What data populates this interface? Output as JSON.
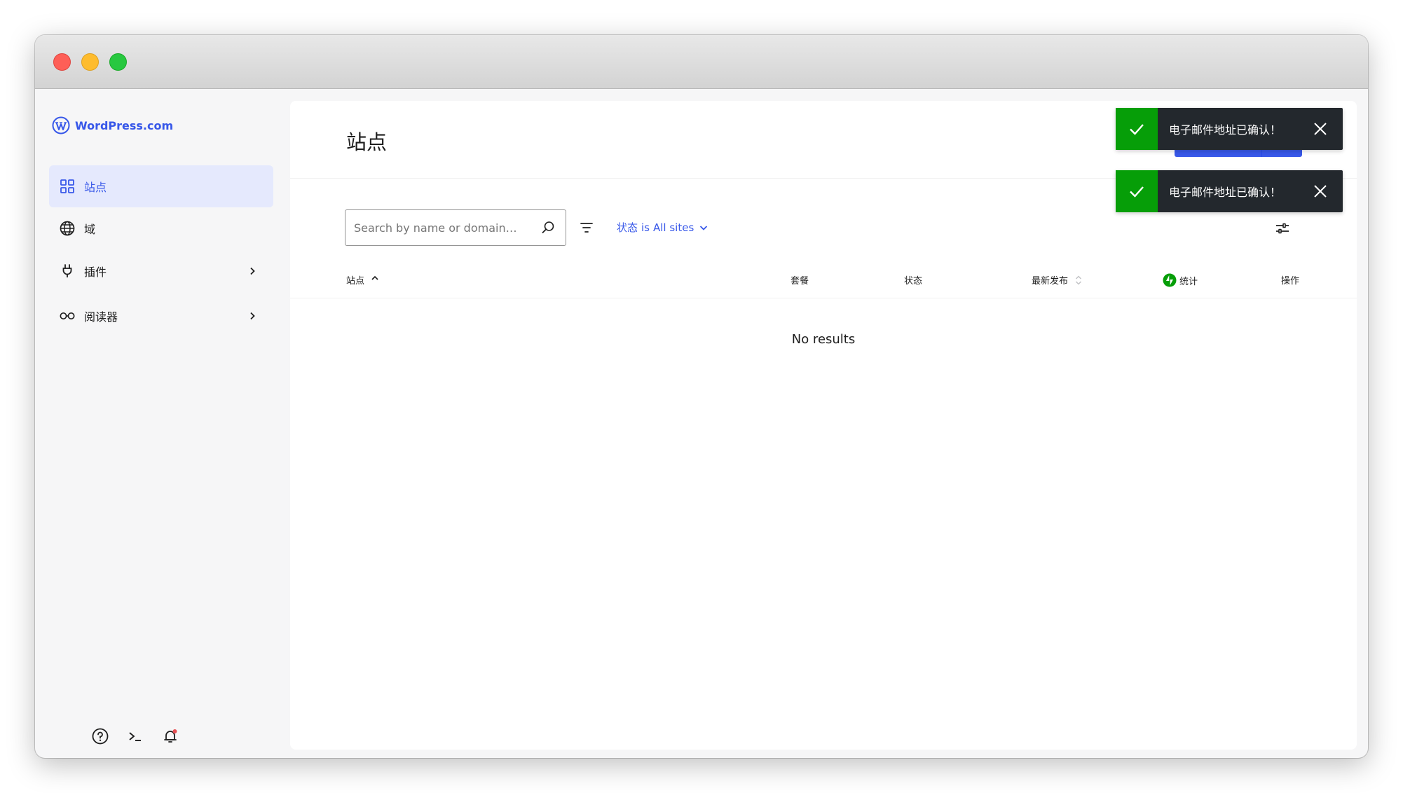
{
  "brand": {
    "name": "WordPress.com",
    "color": "#3858e9"
  },
  "sidebar": {
    "items": [
      {
        "label": "站点",
        "icon": "grid-icon",
        "active": true
      },
      {
        "label": "域",
        "icon": "globe-icon",
        "active": false
      },
      {
        "label": "插件",
        "icon": "plug-icon",
        "active": false,
        "has_submenu": true
      },
      {
        "label": "阅读器",
        "icon": "glasses-icon",
        "active": false,
        "has_submenu": true
      }
    ],
    "footer": [
      "help-icon",
      "terminal-icon",
      "bell-icon"
    ]
  },
  "main": {
    "title": "站点",
    "search": {
      "placeholder": "Search by name or domain…"
    },
    "status_filter": {
      "label": "状态",
      "connector": "is",
      "value": "All sites"
    },
    "table": {
      "columns": [
        "站点",
        "套餐",
        "状态",
        "最新发布",
        "统计",
        "操作"
      ]
    },
    "empty_message": "No results"
  },
  "toasts": [
    {
      "message": "电子邮件地址已确认！"
    },
    {
      "message": "电子邮件地址已确认！"
    }
  ],
  "colors": {
    "accent": "#3858e9",
    "active_bg": "#e5e9fd",
    "success": "#069e08",
    "toast_bg": "#23282d"
  }
}
